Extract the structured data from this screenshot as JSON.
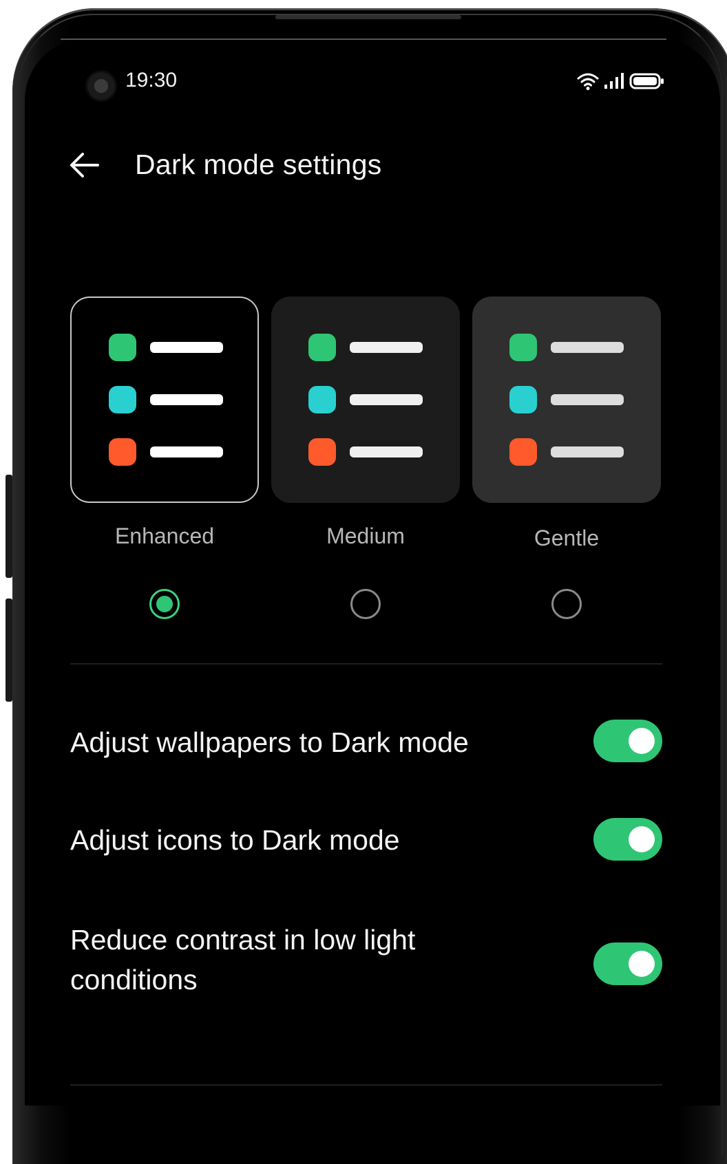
{
  "status_bar": {
    "time": "19:30",
    "icons": [
      "camera-icon",
      "wifi-icon",
      "signal-icon",
      "battery-icon"
    ]
  },
  "header": {
    "title": "Dark mode settings",
    "back_icon": "arrow-left-icon"
  },
  "themes": {
    "selected": "Enhanced",
    "options": [
      {
        "label": "Enhanced",
        "selected": true
      },
      {
        "label": "Medium",
        "selected": false
      },
      {
        "label": "Gentle",
        "selected": false
      }
    ],
    "preview_colors": [
      "#2ec674",
      "#2ad0d0",
      "#ff5a2c"
    ]
  },
  "settings": [
    {
      "label": "Adjust wallpapers to Dark mode",
      "enabled": true
    },
    {
      "label": "Adjust icons to Dark mode",
      "enabled": true
    },
    {
      "label": "Reduce contrast in low light conditions",
      "enabled": true
    }
  ],
  "colors": {
    "accent": "#2ec674",
    "background": "#000000",
    "text": "#f4f4f4",
    "muted_text": "#b7b7b7"
  }
}
